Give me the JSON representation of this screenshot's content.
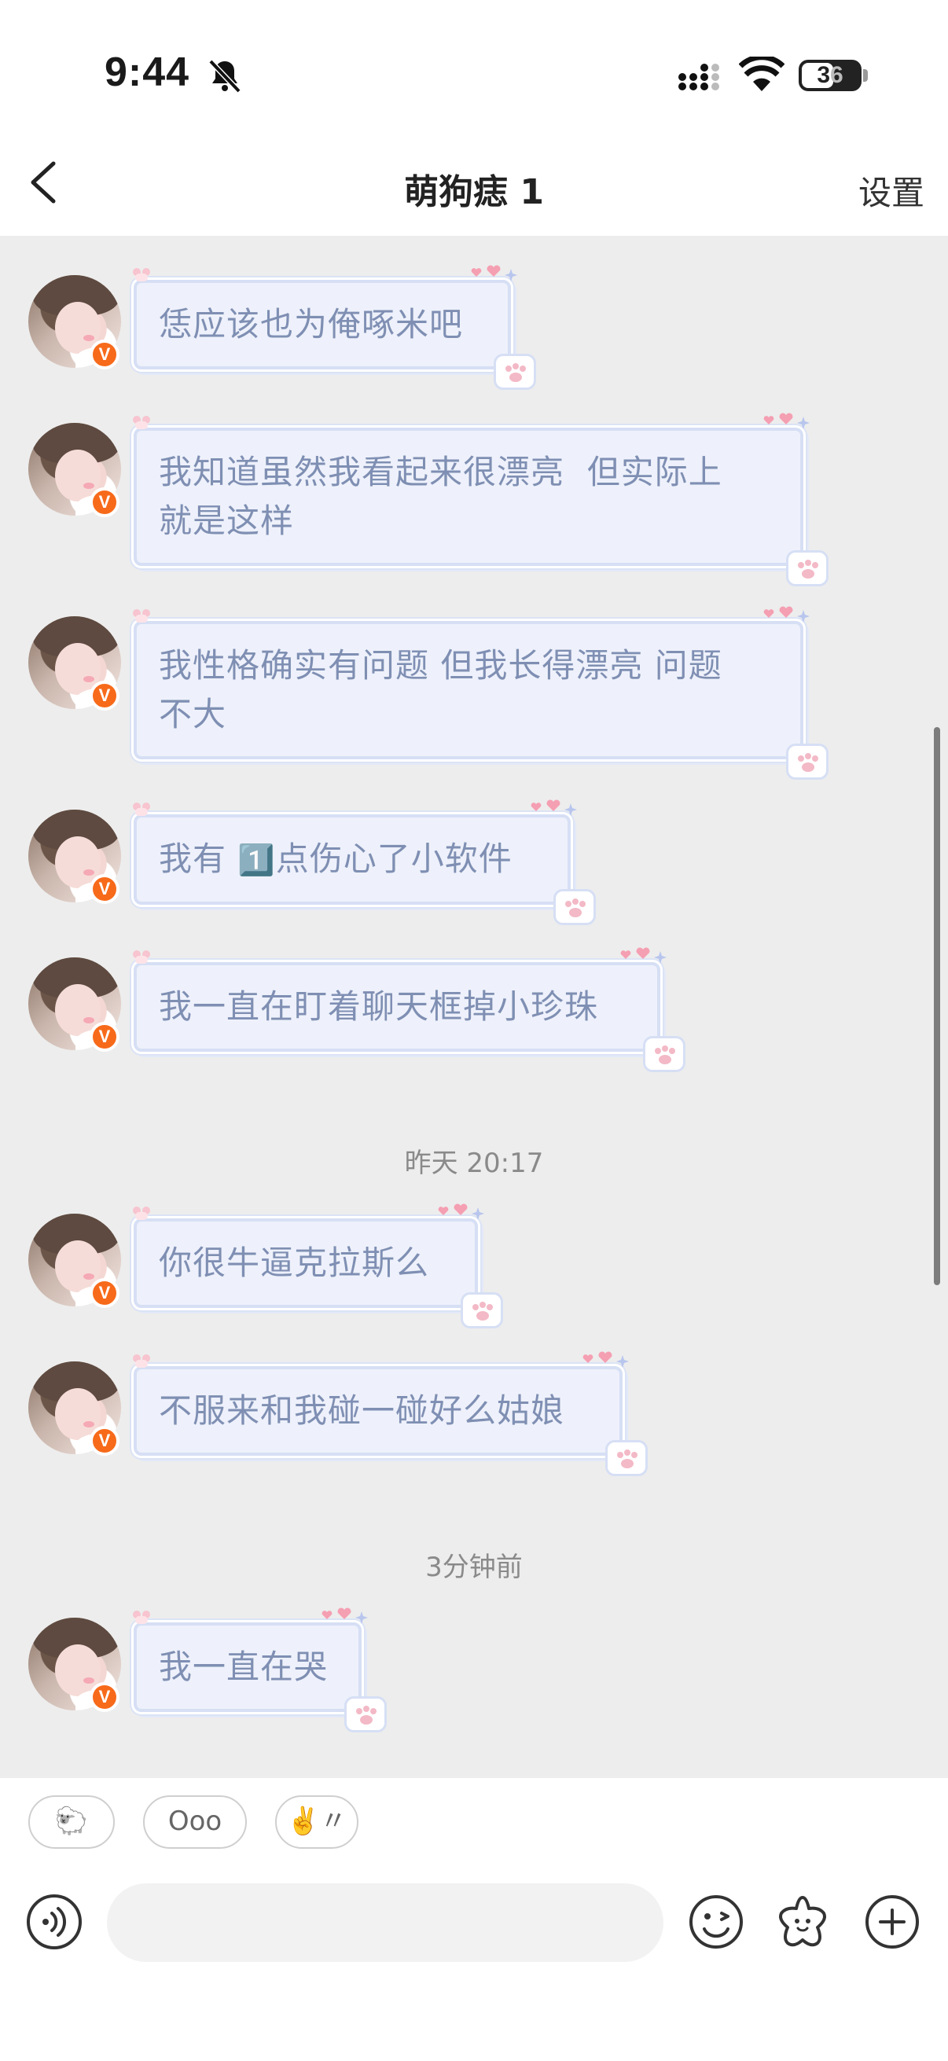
{
  "status_bar": {
    "time": "9:44",
    "battery": "36"
  },
  "header": {
    "title": "萌狗痣 1",
    "settings_label": "设置"
  },
  "messages_block_1": [
    {
      "text": "恁应该也为俺啄米吧"
    },
    {
      "text": "我知道虽然我看起来很漂亮  但实际上\n就是这样"
    },
    {
      "text": "我性格确实有问题 但我长得漂亮 问题\n不大"
    },
    {
      "text_before": "我有 ",
      "emoji": "1️⃣",
      "text_after": "点伤心了小软件"
    },
    {
      "text": "我一直在盯着聊天框掉小珍珠"
    }
  ],
  "timestamp_1": "昨天 20:17",
  "messages_block_2": [
    {
      "text": "你很牛逼克拉斯么"
    },
    {
      "text": "不服来和我碰一碰好么姑娘"
    }
  ],
  "timestamp_2": "3分钟前",
  "messages_block_3": [
    {
      "text": "我一直在哭"
    }
  ],
  "avatar_badge": "V",
  "quick_replies": [
    "🐑",
    "Ooo",
    "✌️〃"
  ],
  "composer": {
    "placeholder": ""
  },
  "colors": {
    "bubble_bg": "#eef1fb",
    "bubble_border": "#d6dff4",
    "bubble_text": "#7f8fb3",
    "badge": "#f76a1a",
    "chat_bg": "#ededed"
  }
}
